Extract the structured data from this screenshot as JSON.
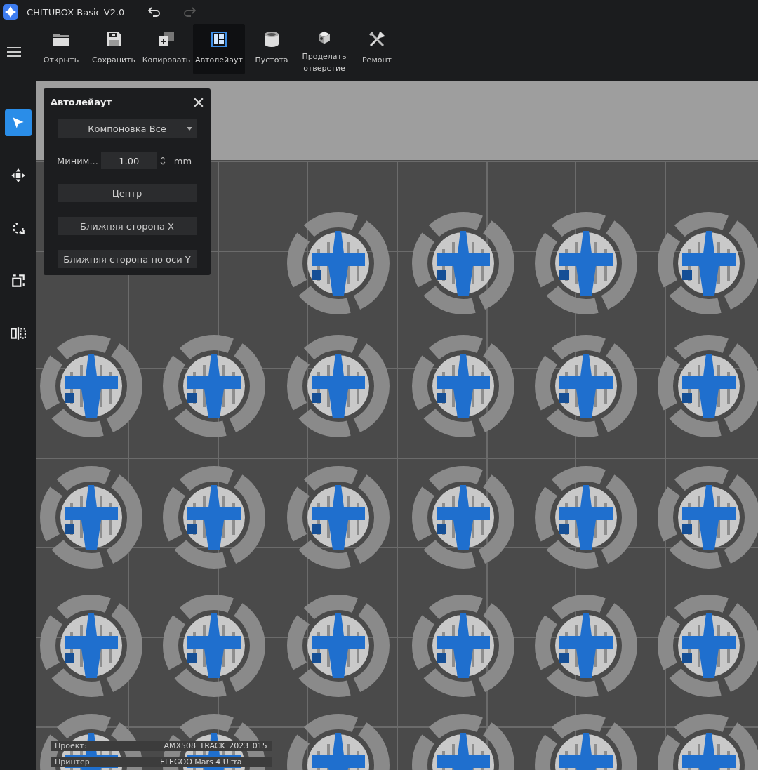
{
  "app": {
    "title": "CHITUBOX Basic V2.0"
  },
  "history": [
    {
      "kind": "undo",
      "disabled": false
    },
    {
      "kind": "redo",
      "disabled": true
    }
  ],
  "toolbar": [
    {
      "kind": "open",
      "label": "Открыть",
      "selected": false
    },
    {
      "kind": "save",
      "label": "Сохранить",
      "selected": false
    },
    {
      "kind": "copy",
      "label": "Копировать",
      "selected": false
    },
    {
      "kind": "layout",
      "label": "Автолейаут",
      "selected": true
    },
    {
      "kind": "hollow",
      "label": "Пустота",
      "selected": false
    },
    {
      "kind": "hole",
      "label": "Проделать отверстие",
      "selected": false
    },
    {
      "kind": "repair",
      "label": "Ремонт",
      "selected": false
    }
  ],
  "sidebar": [
    {
      "kind": "select",
      "selected": true
    },
    {
      "kind": "move",
      "selected": false
    },
    {
      "kind": "rotate",
      "selected": false
    },
    {
      "kind": "scale",
      "selected": false
    },
    {
      "kind": "mirror",
      "selected": false
    }
  ],
  "panel": {
    "title": "Автолейаут",
    "mode": "Компоновка Все",
    "spacing": {
      "label": "Миним...",
      "value": "1.00",
      "unit": "mm"
    },
    "buttons": [
      "Центр",
      "Ближняя сторона X",
      "Ближняя сторона по оси Y"
    ]
  },
  "info": [
    {
      "label": "Проект:",
      "value": "_AMX508_TRACK_2023_015"
    },
    {
      "label": "Принтер",
      "value": "ELEGOO Mars 4 Ultra"
    }
  ]
}
